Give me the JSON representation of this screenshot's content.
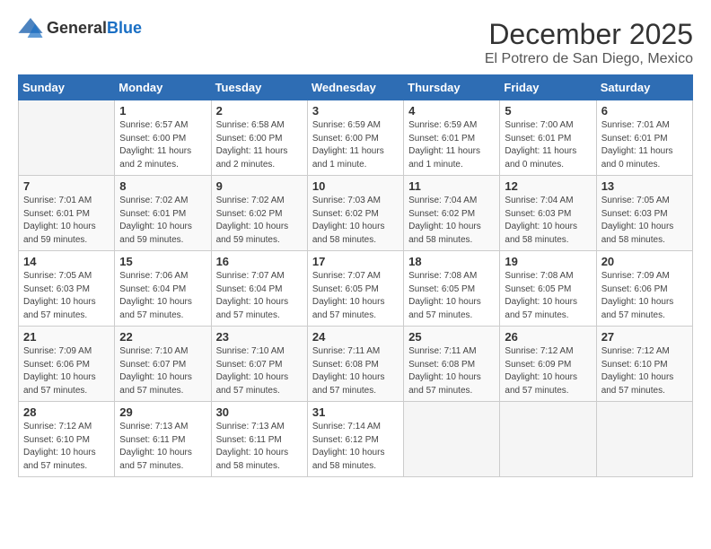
{
  "logo": {
    "general": "General",
    "blue": "Blue"
  },
  "header": {
    "month": "December 2025",
    "location": "El Potrero de San Diego, Mexico"
  },
  "weekdays": [
    "Sunday",
    "Monday",
    "Tuesday",
    "Wednesday",
    "Thursday",
    "Friday",
    "Saturday"
  ],
  "weeks": [
    [
      {
        "day": "",
        "info": ""
      },
      {
        "day": "1",
        "info": "Sunrise: 6:57 AM\nSunset: 6:00 PM\nDaylight: 11 hours\nand 2 minutes."
      },
      {
        "day": "2",
        "info": "Sunrise: 6:58 AM\nSunset: 6:00 PM\nDaylight: 11 hours\nand 2 minutes."
      },
      {
        "day": "3",
        "info": "Sunrise: 6:59 AM\nSunset: 6:00 PM\nDaylight: 11 hours\nand 1 minute."
      },
      {
        "day": "4",
        "info": "Sunrise: 6:59 AM\nSunset: 6:01 PM\nDaylight: 11 hours\nand 1 minute."
      },
      {
        "day": "5",
        "info": "Sunrise: 7:00 AM\nSunset: 6:01 PM\nDaylight: 11 hours\nand 0 minutes."
      },
      {
        "day": "6",
        "info": "Sunrise: 7:01 AM\nSunset: 6:01 PM\nDaylight: 11 hours\nand 0 minutes."
      }
    ],
    [
      {
        "day": "7",
        "info": "Sunrise: 7:01 AM\nSunset: 6:01 PM\nDaylight: 10 hours\nand 59 minutes."
      },
      {
        "day": "8",
        "info": "Sunrise: 7:02 AM\nSunset: 6:01 PM\nDaylight: 10 hours\nand 59 minutes."
      },
      {
        "day": "9",
        "info": "Sunrise: 7:02 AM\nSunset: 6:02 PM\nDaylight: 10 hours\nand 59 minutes."
      },
      {
        "day": "10",
        "info": "Sunrise: 7:03 AM\nSunset: 6:02 PM\nDaylight: 10 hours\nand 58 minutes."
      },
      {
        "day": "11",
        "info": "Sunrise: 7:04 AM\nSunset: 6:02 PM\nDaylight: 10 hours\nand 58 minutes."
      },
      {
        "day": "12",
        "info": "Sunrise: 7:04 AM\nSunset: 6:03 PM\nDaylight: 10 hours\nand 58 minutes."
      },
      {
        "day": "13",
        "info": "Sunrise: 7:05 AM\nSunset: 6:03 PM\nDaylight: 10 hours\nand 58 minutes."
      }
    ],
    [
      {
        "day": "14",
        "info": "Sunrise: 7:05 AM\nSunset: 6:03 PM\nDaylight: 10 hours\nand 57 minutes."
      },
      {
        "day": "15",
        "info": "Sunrise: 7:06 AM\nSunset: 6:04 PM\nDaylight: 10 hours\nand 57 minutes."
      },
      {
        "day": "16",
        "info": "Sunrise: 7:07 AM\nSunset: 6:04 PM\nDaylight: 10 hours\nand 57 minutes."
      },
      {
        "day": "17",
        "info": "Sunrise: 7:07 AM\nSunset: 6:05 PM\nDaylight: 10 hours\nand 57 minutes."
      },
      {
        "day": "18",
        "info": "Sunrise: 7:08 AM\nSunset: 6:05 PM\nDaylight: 10 hours\nand 57 minutes."
      },
      {
        "day": "19",
        "info": "Sunrise: 7:08 AM\nSunset: 6:05 PM\nDaylight: 10 hours\nand 57 minutes."
      },
      {
        "day": "20",
        "info": "Sunrise: 7:09 AM\nSunset: 6:06 PM\nDaylight: 10 hours\nand 57 minutes."
      }
    ],
    [
      {
        "day": "21",
        "info": "Sunrise: 7:09 AM\nSunset: 6:06 PM\nDaylight: 10 hours\nand 57 minutes."
      },
      {
        "day": "22",
        "info": "Sunrise: 7:10 AM\nSunset: 6:07 PM\nDaylight: 10 hours\nand 57 minutes."
      },
      {
        "day": "23",
        "info": "Sunrise: 7:10 AM\nSunset: 6:07 PM\nDaylight: 10 hours\nand 57 minutes."
      },
      {
        "day": "24",
        "info": "Sunrise: 7:11 AM\nSunset: 6:08 PM\nDaylight: 10 hours\nand 57 minutes."
      },
      {
        "day": "25",
        "info": "Sunrise: 7:11 AM\nSunset: 6:08 PM\nDaylight: 10 hours\nand 57 minutes."
      },
      {
        "day": "26",
        "info": "Sunrise: 7:12 AM\nSunset: 6:09 PM\nDaylight: 10 hours\nand 57 minutes."
      },
      {
        "day": "27",
        "info": "Sunrise: 7:12 AM\nSunset: 6:10 PM\nDaylight: 10 hours\nand 57 minutes."
      }
    ],
    [
      {
        "day": "28",
        "info": "Sunrise: 7:12 AM\nSunset: 6:10 PM\nDaylight: 10 hours\nand 57 minutes."
      },
      {
        "day": "29",
        "info": "Sunrise: 7:13 AM\nSunset: 6:11 PM\nDaylight: 10 hours\nand 57 minutes."
      },
      {
        "day": "30",
        "info": "Sunrise: 7:13 AM\nSunset: 6:11 PM\nDaylight: 10 hours\nand 58 minutes."
      },
      {
        "day": "31",
        "info": "Sunrise: 7:14 AM\nSunset: 6:12 PM\nDaylight: 10 hours\nand 58 minutes."
      },
      {
        "day": "",
        "info": ""
      },
      {
        "day": "",
        "info": ""
      },
      {
        "day": "",
        "info": ""
      }
    ]
  ]
}
